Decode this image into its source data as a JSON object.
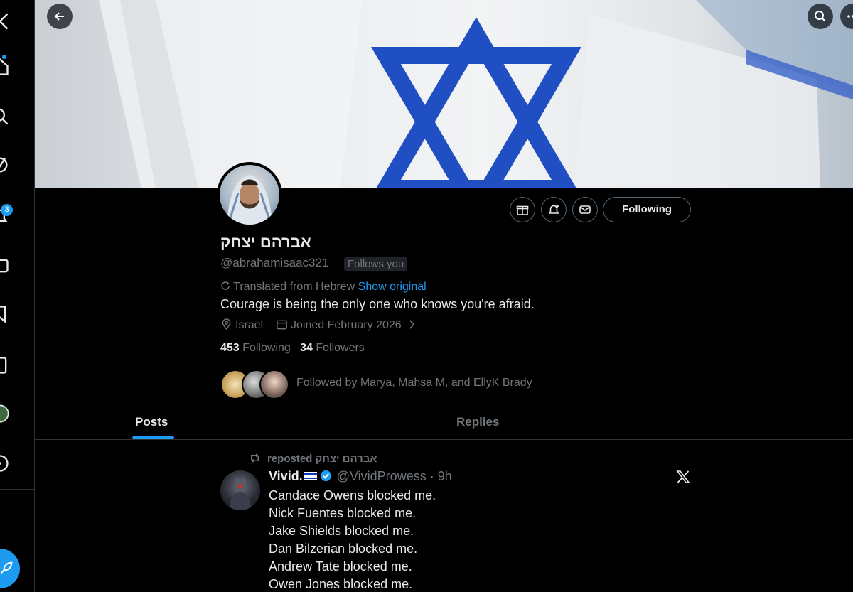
{
  "nav": {
    "notification_count": "3"
  },
  "profile": {
    "display_name": "אברהם יצחק",
    "handle": "@abrahamisaac321",
    "follows_you": "Follows you",
    "translated_label": "Translated from Hebrew",
    "show_original": "Show original",
    "bio": "Courage is being the only one who knows you're afraid.",
    "location": "Israel",
    "joined": "Joined February 2026",
    "following_count": "453",
    "following_label": "Following",
    "followers_count": "34",
    "followers_label": "Followers",
    "followed_by": "Followed by Marya, Mahsa M, and EllyK Brady",
    "follow_button": "Following"
  },
  "tabs": [
    {
      "label": "Posts",
      "active": true
    },
    {
      "label": "Replies",
      "active": false
    }
  ],
  "post": {
    "repost_label": "reposted אברהם יצחק",
    "author_name": "Vivid.",
    "author_handle": "@VividProwess",
    "time": "· 9h",
    "lines": [
      "Candace Owens blocked me.",
      "Nick Fuentes blocked me.",
      "Jake Shields blocked me.",
      "Dan Bilzerian blocked me.",
      "Andrew Tate blocked me.",
      "Owen Jones blocked me."
    ]
  },
  "colors": {
    "accent": "#1d9bf0",
    "background": "#000000",
    "secondary_text": "#71767b",
    "flag_blue": "#0038b8"
  }
}
